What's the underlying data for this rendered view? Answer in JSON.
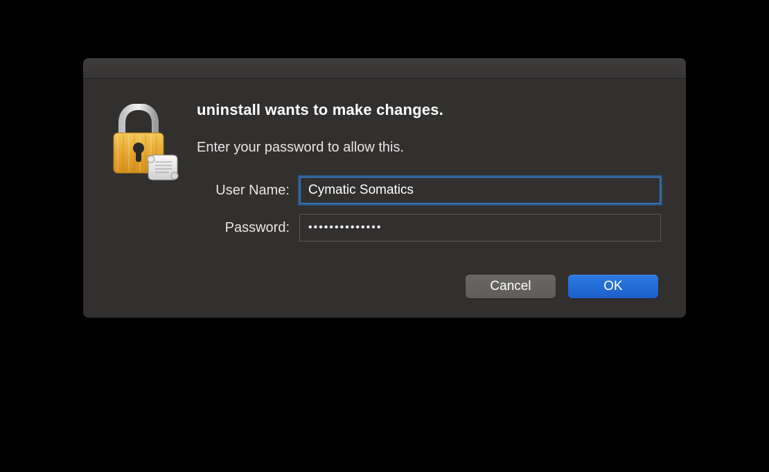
{
  "dialog": {
    "heading": "uninstall wants to make changes.",
    "subtext": "Enter your password to allow this.",
    "fields": {
      "username_label": "User Name:",
      "username_value": "Cymatic Somatics",
      "password_label": "Password:",
      "password_value": "••••••••••••••"
    },
    "buttons": {
      "cancel": "Cancel",
      "ok": "OK"
    }
  },
  "icons": {
    "lock": "lock-icon",
    "script_badge": "script-badge-icon"
  }
}
